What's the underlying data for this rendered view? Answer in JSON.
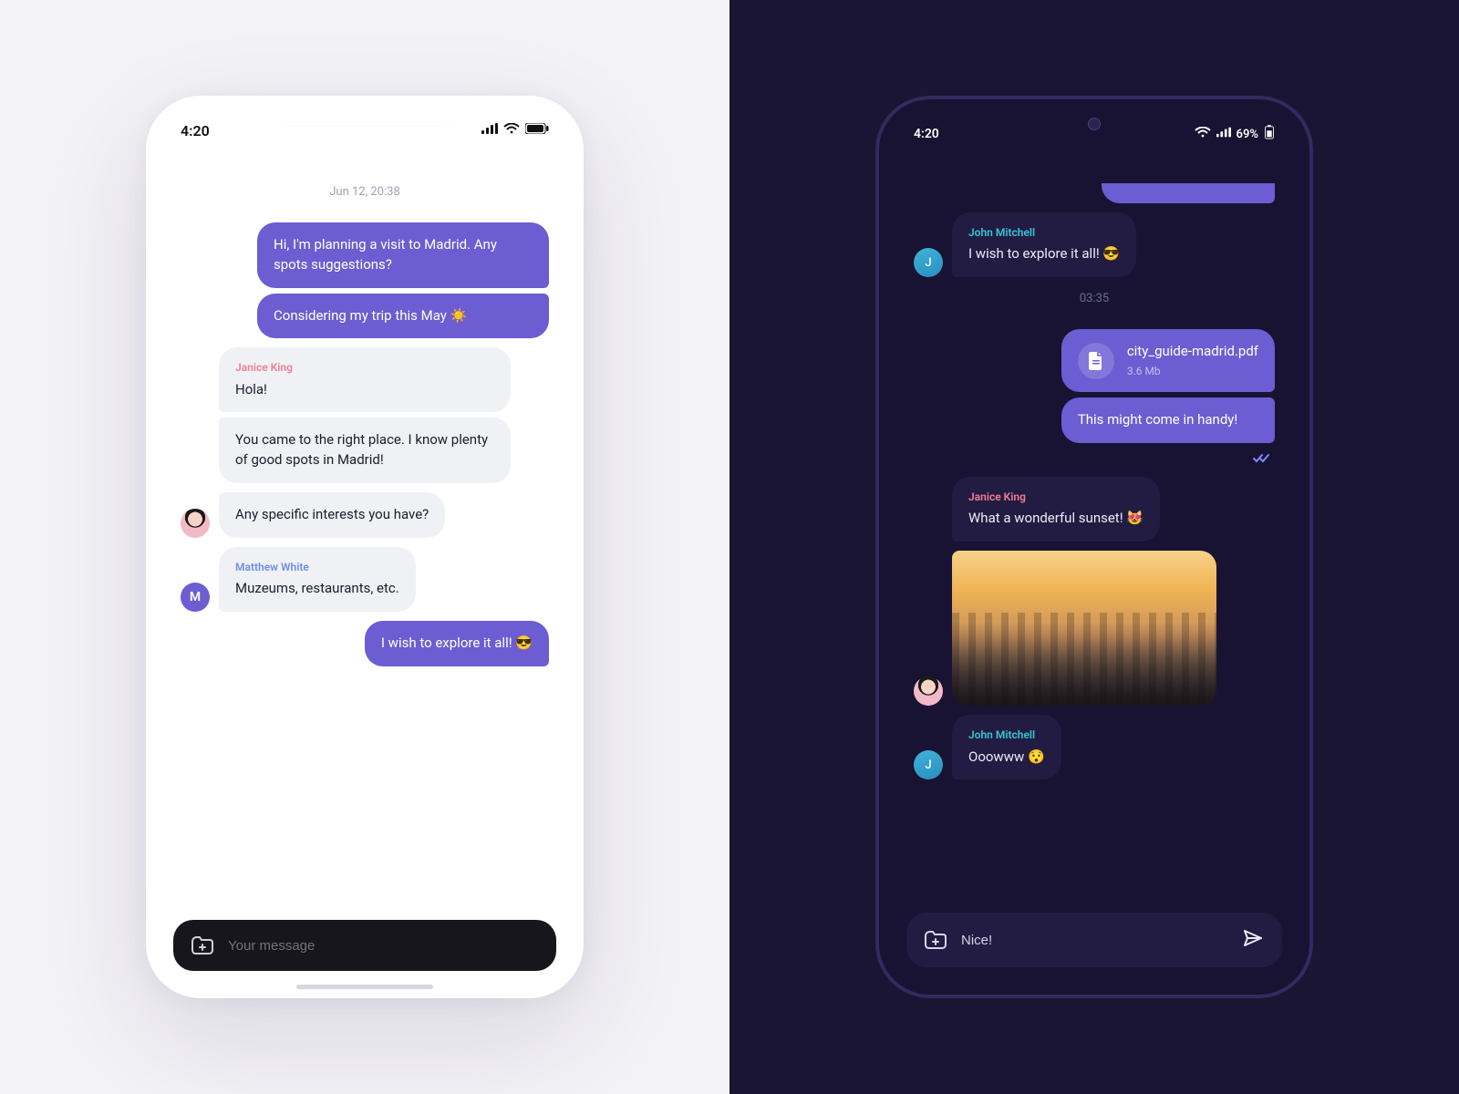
{
  "light": {
    "status": {
      "time": "4:20"
    },
    "date_sep": "Jun 12, 20:38",
    "me1": "Hi, I'm planning a visit to Madrid. Any spots suggestions?",
    "me2": "Considering my trip this May ☀️",
    "janice_name": "Janice King",
    "janice1": "Hola!",
    "janice2": "You came to the right place. I know plenty of good spots in Madrid!",
    "janice3": "Any specific interests you have?",
    "matt_name": "Matthew White",
    "matt_initial": "M",
    "matt1": "Muzeums, restaurants, etc.",
    "me3": "I wish to explore it all! 😎",
    "composer_placeholder": "Your message"
  },
  "dark": {
    "status": {
      "time": "4:20",
      "battery": "69%"
    },
    "john_name": "John Mitchell",
    "john_initial": "J",
    "john1": "I wish to explore it all! 😎",
    "time_sep": "03:35",
    "file_name": "city_guide-madrid.pdf",
    "file_size": "3.6 Mb",
    "me_file_caption": "This might come in handy!",
    "janice_name": "Janice King",
    "janice1": "What a wonderful sunset! 😻",
    "john2": "Ooowww 😯",
    "composer_value": "Nice!"
  }
}
